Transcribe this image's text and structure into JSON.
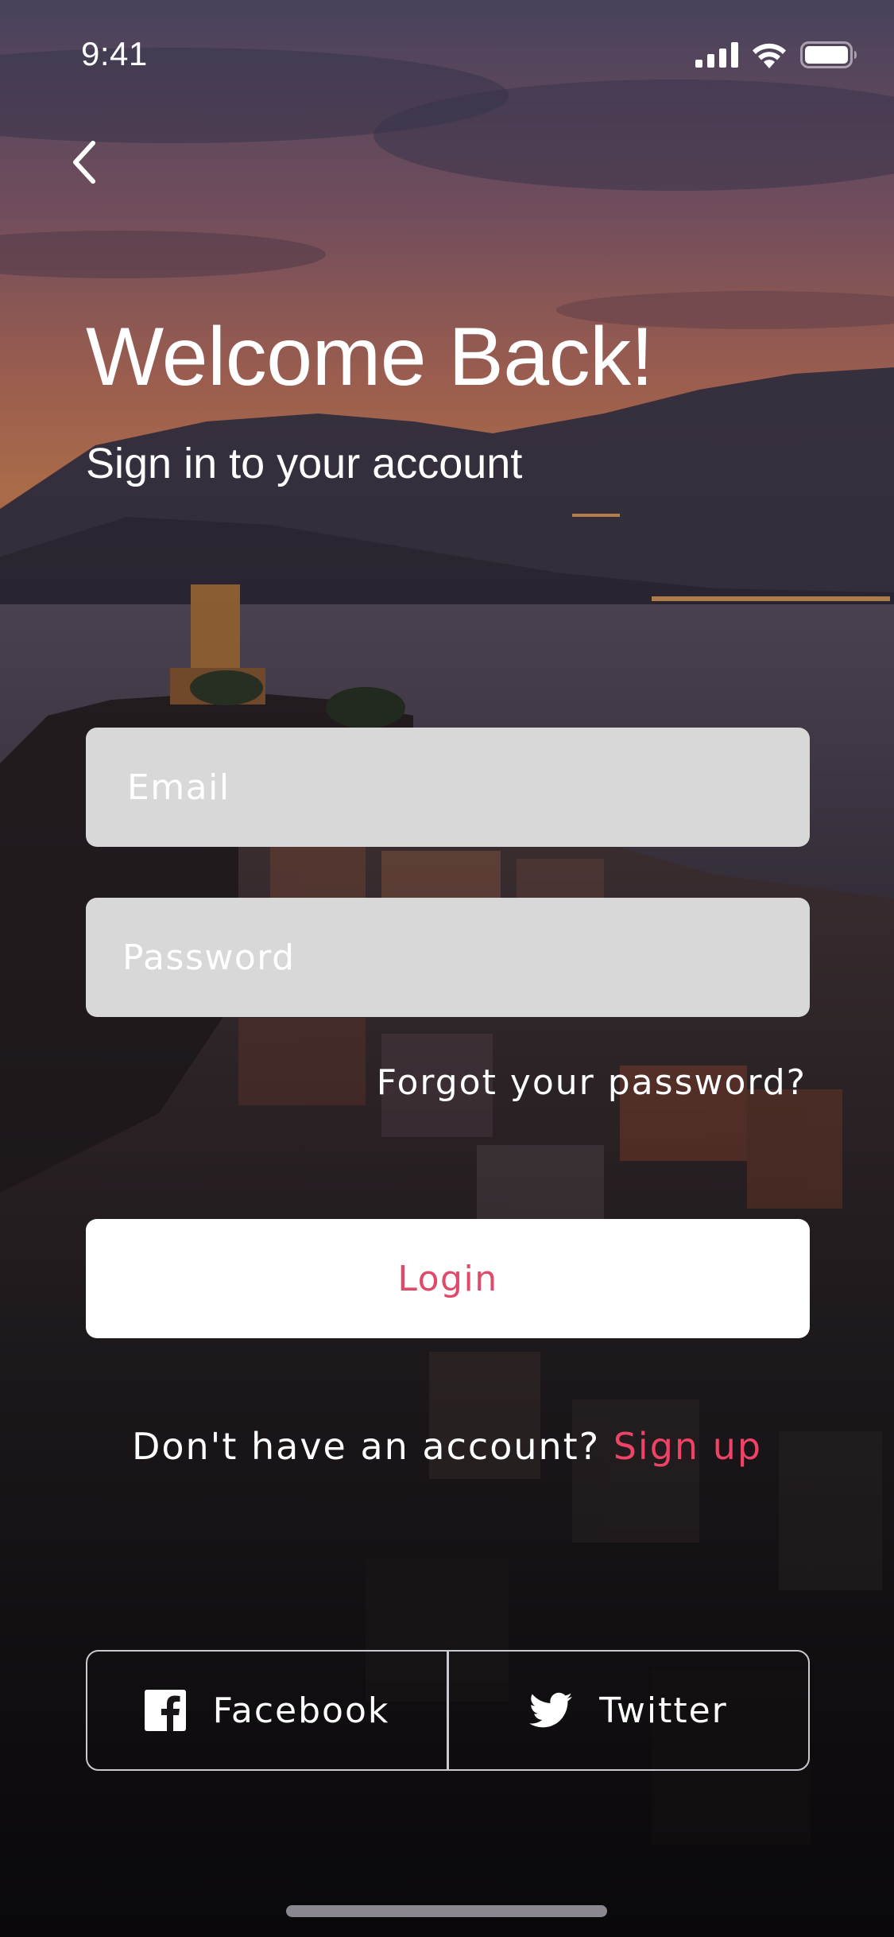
{
  "status_bar": {
    "time": "9:41",
    "icons": [
      "cellular-signal-icon",
      "wifi-icon",
      "battery-icon"
    ]
  },
  "nav": {
    "back_icon": "chevron-left-icon"
  },
  "header": {
    "title": "Welcome Back!",
    "subtitle": "Sign in to your account"
  },
  "form": {
    "email_placeholder": "Email",
    "password_placeholder": "Password",
    "forgot_password": "Forgot your password?",
    "login_label": "Login"
  },
  "signup": {
    "prompt": "Don't have an account?",
    "link": "Sign up"
  },
  "social": {
    "facebook_label": "Facebook",
    "twitter_label": "Twitter"
  },
  "colors": {
    "accent": "#ee4266",
    "input_bg": "#d8d8d8",
    "button_bg": "#ffffff"
  }
}
